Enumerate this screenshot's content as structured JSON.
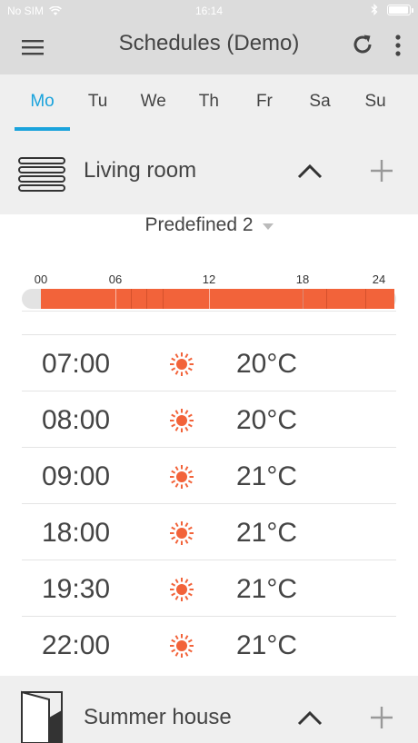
{
  "status_bar": {
    "carrier": "No SIM",
    "time": "16:14",
    "battery_level": 1.0
  },
  "app_bar": {
    "title": "Schedules (Demo)",
    "icons": [
      "menu-icon",
      "refresh-icon",
      "more-vert-icon"
    ]
  },
  "tabs": {
    "active": "Mo",
    "items": [
      "Mo",
      "Tu",
      "We",
      "Th",
      "Fr",
      "Sa",
      "Su"
    ]
  },
  "colors": {
    "accent": "#1aa3dc",
    "heating": "#f2633a",
    "header_bg": "#dcdcdc",
    "group_bg": "#efefef"
  },
  "groups": [
    {
      "name": "Living room",
      "icon": "radiator-icon"
    },
    {
      "name": "Summer house",
      "icon": "door-icon"
    }
  ],
  "program": {
    "selected": "Predefined 2"
  },
  "timeline": {
    "tick_labels": [
      "00",
      "06",
      "12",
      "18",
      "24"
    ],
    "active_from_hour": 1.2,
    "active_to_hour": 23.9,
    "switch_hours": [
      7,
      8,
      9,
      18,
      19.5,
      22
    ]
  },
  "entries": [
    {
      "time": "07:00",
      "icon": "sun-icon",
      "temp": "20°C"
    },
    {
      "time": "08:00",
      "icon": "sun-icon",
      "temp": "20°C"
    },
    {
      "time": "09:00",
      "icon": "sun-icon",
      "temp": "21°C"
    },
    {
      "time": "18:00",
      "icon": "sun-icon",
      "temp": "21°C"
    },
    {
      "time": "19:30",
      "icon": "sun-icon",
      "temp": "21°C"
    },
    {
      "time": "22:00",
      "icon": "sun-icon",
      "temp": "21°C"
    }
  ]
}
